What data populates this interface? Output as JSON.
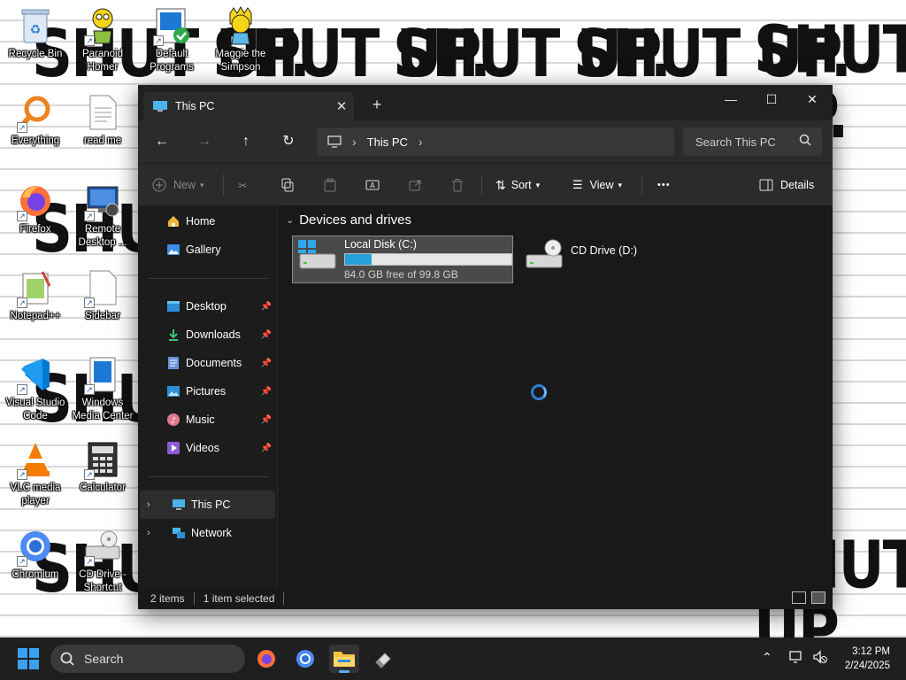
{
  "wallpaper": {
    "text": "SHUT UP."
  },
  "desktop": {
    "icons": [
      {
        "label": "Recycle Bin",
        "icon": "recycle-bin-icon"
      },
      {
        "label": "Paranoid Homer",
        "icon": "homer-icon"
      },
      {
        "label": "Default Programs",
        "icon": "default-programs-icon"
      },
      {
        "label": "Maggie the Simpson",
        "icon": "maggie-icon"
      },
      {
        "label": "Everything",
        "icon": "everything-search-icon"
      },
      {
        "label": "read me",
        "icon": "text-file-icon"
      },
      {
        "label": "Firefox",
        "icon": "firefox-icon"
      },
      {
        "label": "Remote Desktop ...",
        "icon": "remote-desktop-icon"
      },
      {
        "label": "Notepad++",
        "icon": "notepadpp-icon"
      },
      {
        "label": "Sidebar",
        "icon": "blank-file-icon"
      },
      {
        "label": "Visual Studio Code",
        "icon": "vscode-icon"
      },
      {
        "label": "Windows Media Center",
        "icon": "media-center-icon"
      },
      {
        "label": "VLC media player",
        "icon": "vlc-icon"
      },
      {
        "label": "Calculator",
        "icon": "calculator-icon"
      },
      {
        "label": "Chromium",
        "icon": "chromium-icon"
      },
      {
        "label": "CD Drive - Shortcut",
        "icon": "cd-drive-icon"
      }
    ]
  },
  "explorer": {
    "tab": {
      "title": "This PC",
      "close": "✕"
    },
    "new_tab": "+",
    "window_controls": {
      "minimize": "—",
      "maximize": "☐",
      "close": "✕"
    },
    "nav": {
      "back": "←",
      "forward": "→",
      "up": "↑",
      "refresh": "↻"
    },
    "address": {
      "crumb": "This PC"
    },
    "search": {
      "placeholder": "Search This PC"
    },
    "toolbar": {
      "new": "New",
      "sort": "Sort",
      "view": "View",
      "more": "•••",
      "details": "Details"
    },
    "sidebar": {
      "home": "Home",
      "gallery": "Gallery",
      "desktop": "Desktop",
      "downloads": "Downloads",
      "documents": "Documents",
      "pictures": "Pictures",
      "music": "Music",
      "videos": "Videos",
      "this_pc": "This PC",
      "network": "Network"
    },
    "content": {
      "group_title": "Devices and drives",
      "drives": [
        {
          "name": "Local Disk (C:)",
          "free": "84.0 GB free of 99.8 GB",
          "used_fraction": 0.158
        },
        {
          "name": "CD Drive (D:)"
        }
      ]
    },
    "status": {
      "items": "2 items",
      "selected": "1 item selected"
    }
  },
  "taskbar": {
    "search": "Search",
    "time": "3:12 PM",
    "date": "2/24/2025"
  },
  "colors": {
    "accent": "#26a0da",
    "window_bg": "#191919",
    "taskbar_bg": "#1f1f1f"
  }
}
